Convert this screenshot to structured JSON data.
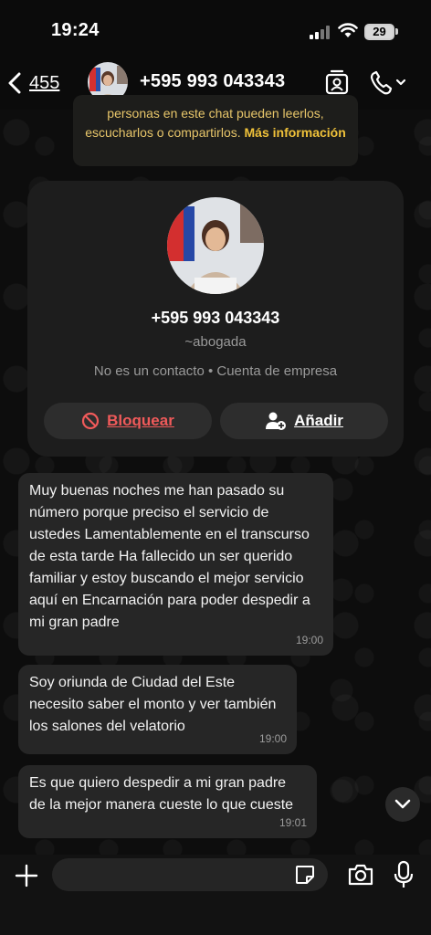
{
  "status_bar": {
    "time": "19:24",
    "battery": "29"
  },
  "header": {
    "back_count": "455",
    "title": "+595 993 043343"
  },
  "notice": {
    "text": "personas en este chat pueden leerlos, escucharlos o compartirlos.",
    "link": "Más información"
  },
  "profile": {
    "number": "+595 993 043343",
    "username": "~abogada",
    "meta": "No es un contacto • Cuenta de empresa",
    "block_label": "Bloquear",
    "add_label": "Añadir"
  },
  "messages": [
    {
      "text": "Muy buenas noches me han pasado su número porque preciso el servicio de ustedes Lamentablemente en el transcurso de esta tarde Ha fallecido un ser querido familiar y estoy buscando el mejor servicio aquí en Encarnación para poder despedir a mi gran padre",
      "time": "19:00"
    },
    {
      "text": "Soy oriunda de Ciudad del Este necesito saber el monto y ver también los salones del velatorio",
      "time": "19:00"
    },
    {
      "text": "Es que quiero despedir a mi gran padre de la mejor manera cueste lo que cueste",
      "time": "19:01"
    }
  ],
  "composer": {
    "placeholder": ""
  },
  "colors": {
    "accent_link": "#f0c23a",
    "block_red": "#f05a5a",
    "bubble": "#262626"
  }
}
